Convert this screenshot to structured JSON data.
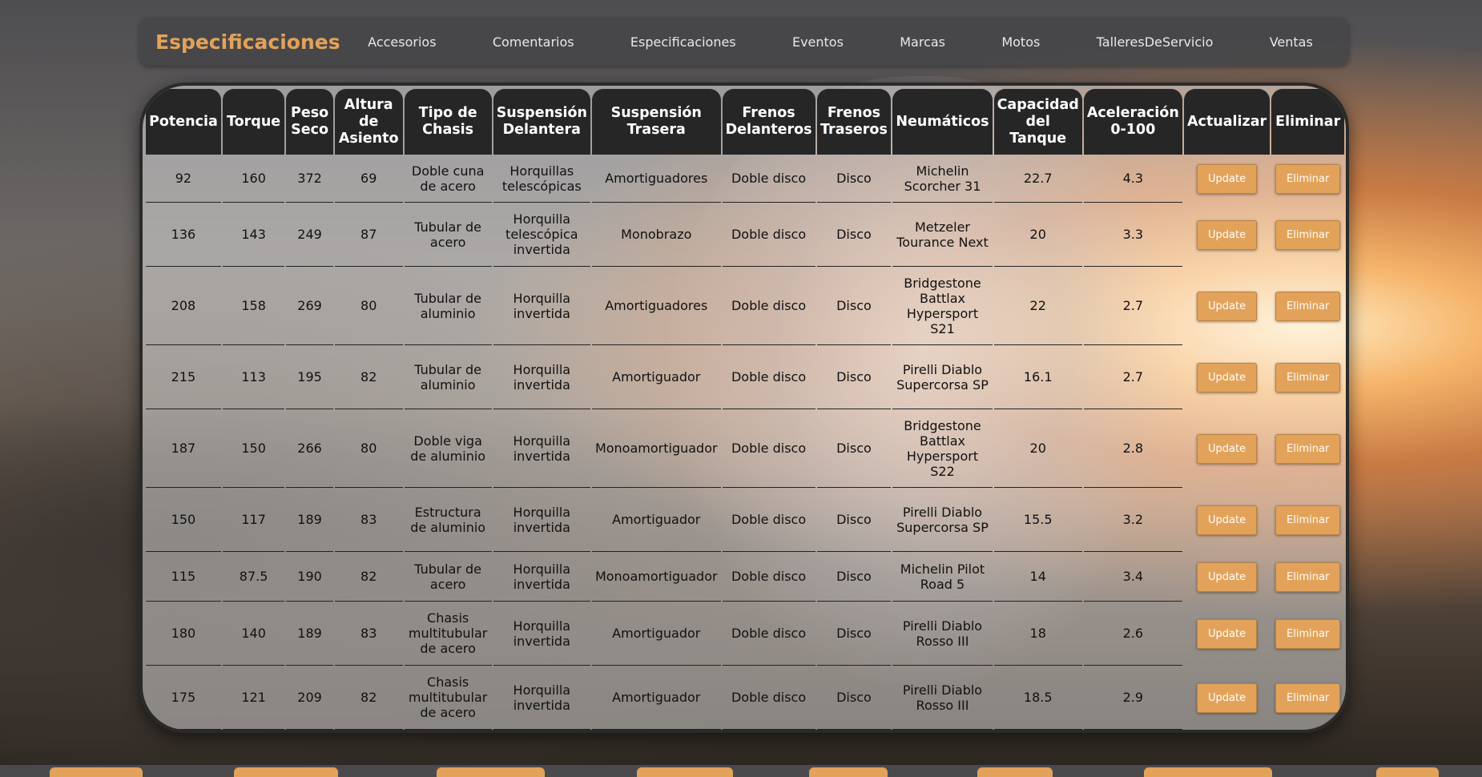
{
  "navbar": {
    "brand": "Especificaciones",
    "links": [
      "Accesorios",
      "Comentarios",
      "Especificaciones",
      "Eventos",
      "Marcas",
      "Motos",
      "TalleresDeServicio",
      "Ventas"
    ]
  },
  "table": {
    "columns": [
      "Potencia",
      "Torque",
      "Peso Seco",
      "Altura de Asiento",
      "Tipo de Chasis",
      "Suspensión Delantera",
      "Suspensión Trasera",
      "Frenos Delanteros",
      "Frenos Traseros",
      "Neumáticos",
      "Capacidad del Tanque",
      "Aceleración 0-100",
      "Actualizar",
      "Eliminar"
    ],
    "update_label": "Update",
    "delete_label": "Eliminar",
    "rows": [
      [
        "92",
        "160",
        "372",
        "69",
        "Doble cuna de acero",
        "Horquillas telescópicas",
        "Amortiguadores",
        "Doble disco",
        "Disco",
        "Michelin Scorcher 31",
        "22.7",
        "4.3"
      ],
      [
        "136",
        "143",
        "249",
        "87",
        "Tubular de acero",
        "Horquilla telescópica invertida",
        "Monobrazo",
        "Doble disco",
        "Disco",
        "Metzeler Tourance Next",
        "20",
        "3.3"
      ],
      [
        "208",
        "158",
        "269",
        "80",
        "Tubular de aluminio",
        "Horquilla invertida",
        "Amortiguadores",
        "Doble disco",
        "Disco",
        "Bridgestone Battlax Hypersport S21",
        "22",
        "2.7"
      ],
      [
        "215",
        "113",
        "195",
        "82",
        "Tubular de aluminio",
        "Horquilla invertida",
        "Amortiguador",
        "Doble disco",
        "Disco",
        "Pirelli Diablo Supercorsa SP",
        "16.1",
        "2.7"
      ],
      [
        "187",
        "150",
        "266",
        "80",
        "Doble viga de aluminio",
        "Horquilla invertida",
        "Monoamortiguador",
        "Doble disco",
        "Disco",
        "Bridgestone Battlax Hypersport S22",
        "20",
        "2.8"
      ],
      [
        "150",
        "117",
        "189",
        "83",
        "Estructura de aluminio",
        "Horquilla invertida",
        "Amortiguador",
        "Doble disco",
        "Disco",
        "Pirelli Diablo Supercorsa SP",
        "15.5",
        "3.2"
      ],
      [
        "115",
        "87.5",
        "190",
        "82",
        "Tubular de acero",
        "Horquilla invertida",
        "Monoamortiguador",
        "Doble disco",
        "Disco",
        "Michelin Pilot Road 5",
        "14",
        "3.4"
      ],
      [
        "180",
        "140",
        "189",
        "83",
        "Chasis multitubular de acero",
        "Horquilla invertida",
        "Amortiguador",
        "Doble disco",
        "Disco",
        "Pirelli Diablo Rosso III",
        "18",
        "2.6"
      ],
      [
        "175",
        "121",
        "209",
        "82",
        "Chasis multitubular de acero",
        "Horquilla invertida",
        "Amortiguador",
        "Doble disco",
        "Disco",
        "Pirelli Diablo Rosso III",
        "18.5",
        "2.9"
      ]
    ]
  }
}
